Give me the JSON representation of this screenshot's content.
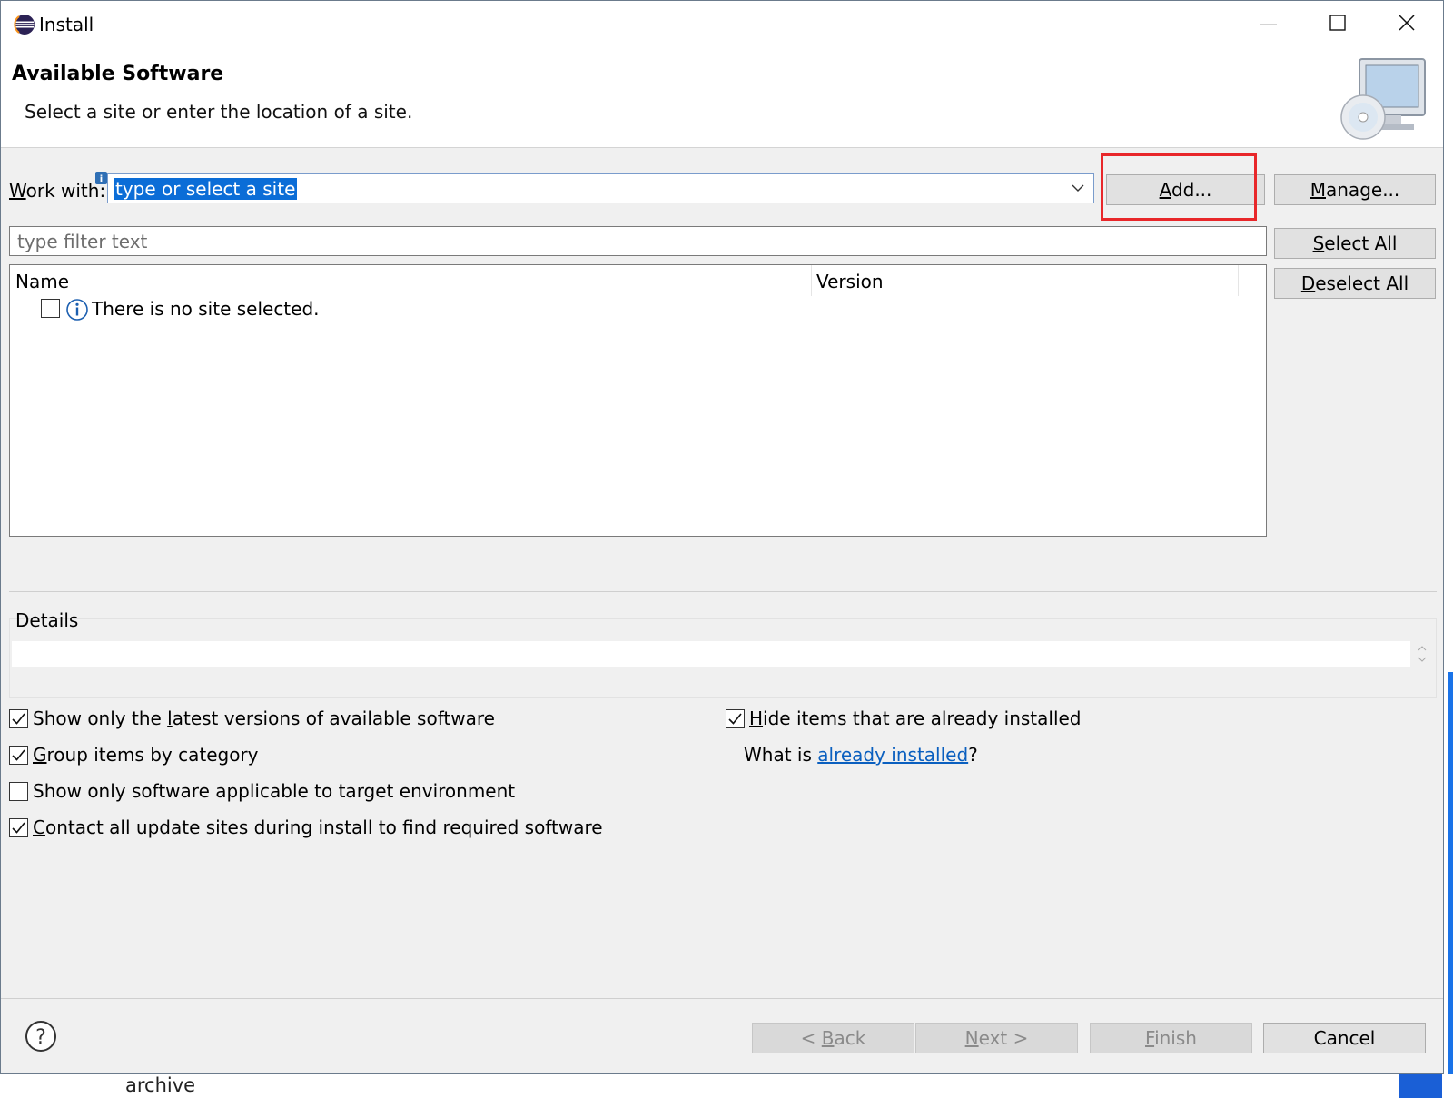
{
  "window": {
    "title": "Install"
  },
  "header": {
    "title": "Available Software",
    "description": "Select a site or enter the location of a site."
  },
  "work_with": {
    "label_prefix": "W",
    "label_rest": "ork with:",
    "value": "type or select a site",
    "add_button_prefix": "A",
    "add_button_rest": "dd...",
    "manage_button_prefix": "M",
    "manage_button_rest": "anage..."
  },
  "filter": {
    "placeholder": "type filter text"
  },
  "side_buttons": {
    "select_all_prefix": "S",
    "select_all_rest": "elect All",
    "deselect_all_prefix": "D",
    "deselect_all_rest": "eselect All"
  },
  "tree": {
    "columns": [
      "Name",
      "Version"
    ],
    "empty_message": "There is no site selected."
  },
  "details": {
    "label": "Details"
  },
  "options": {
    "latest_pre": "Show only the ",
    "latest_u": "l",
    "latest_post": "atest versions of available software",
    "group_pre": "",
    "group_u": "G",
    "group_post": "roup items by category",
    "target_text": "Show only software applicable to target environment",
    "contact_pre": "",
    "contact_u": "C",
    "contact_post": "ontact all update sites during install to find required software",
    "hide_pre": "",
    "hide_u": "H",
    "hide_post": "ide items that are already installed",
    "what_is_pre": "What is ",
    "what_is_link": "already installed",
    "what_is_post": "?"
  },
  "footer": {
    "back_pre": "< ",
    "back_u": "B",
    "back_post": "ack",
    "next_u": "N",
    "next_post": "ext >",
    "finish_u": "F",
    "finish_post": "inish",
    "cancel": "Cancel"
  },
  "desktop": {
    "bottom_label": "archive"
  },
  "colors": {
    "accent": "#0b6dd7",
    "highlight": "#e8272a",
    "link": "#0a5fbf"
  }
}
